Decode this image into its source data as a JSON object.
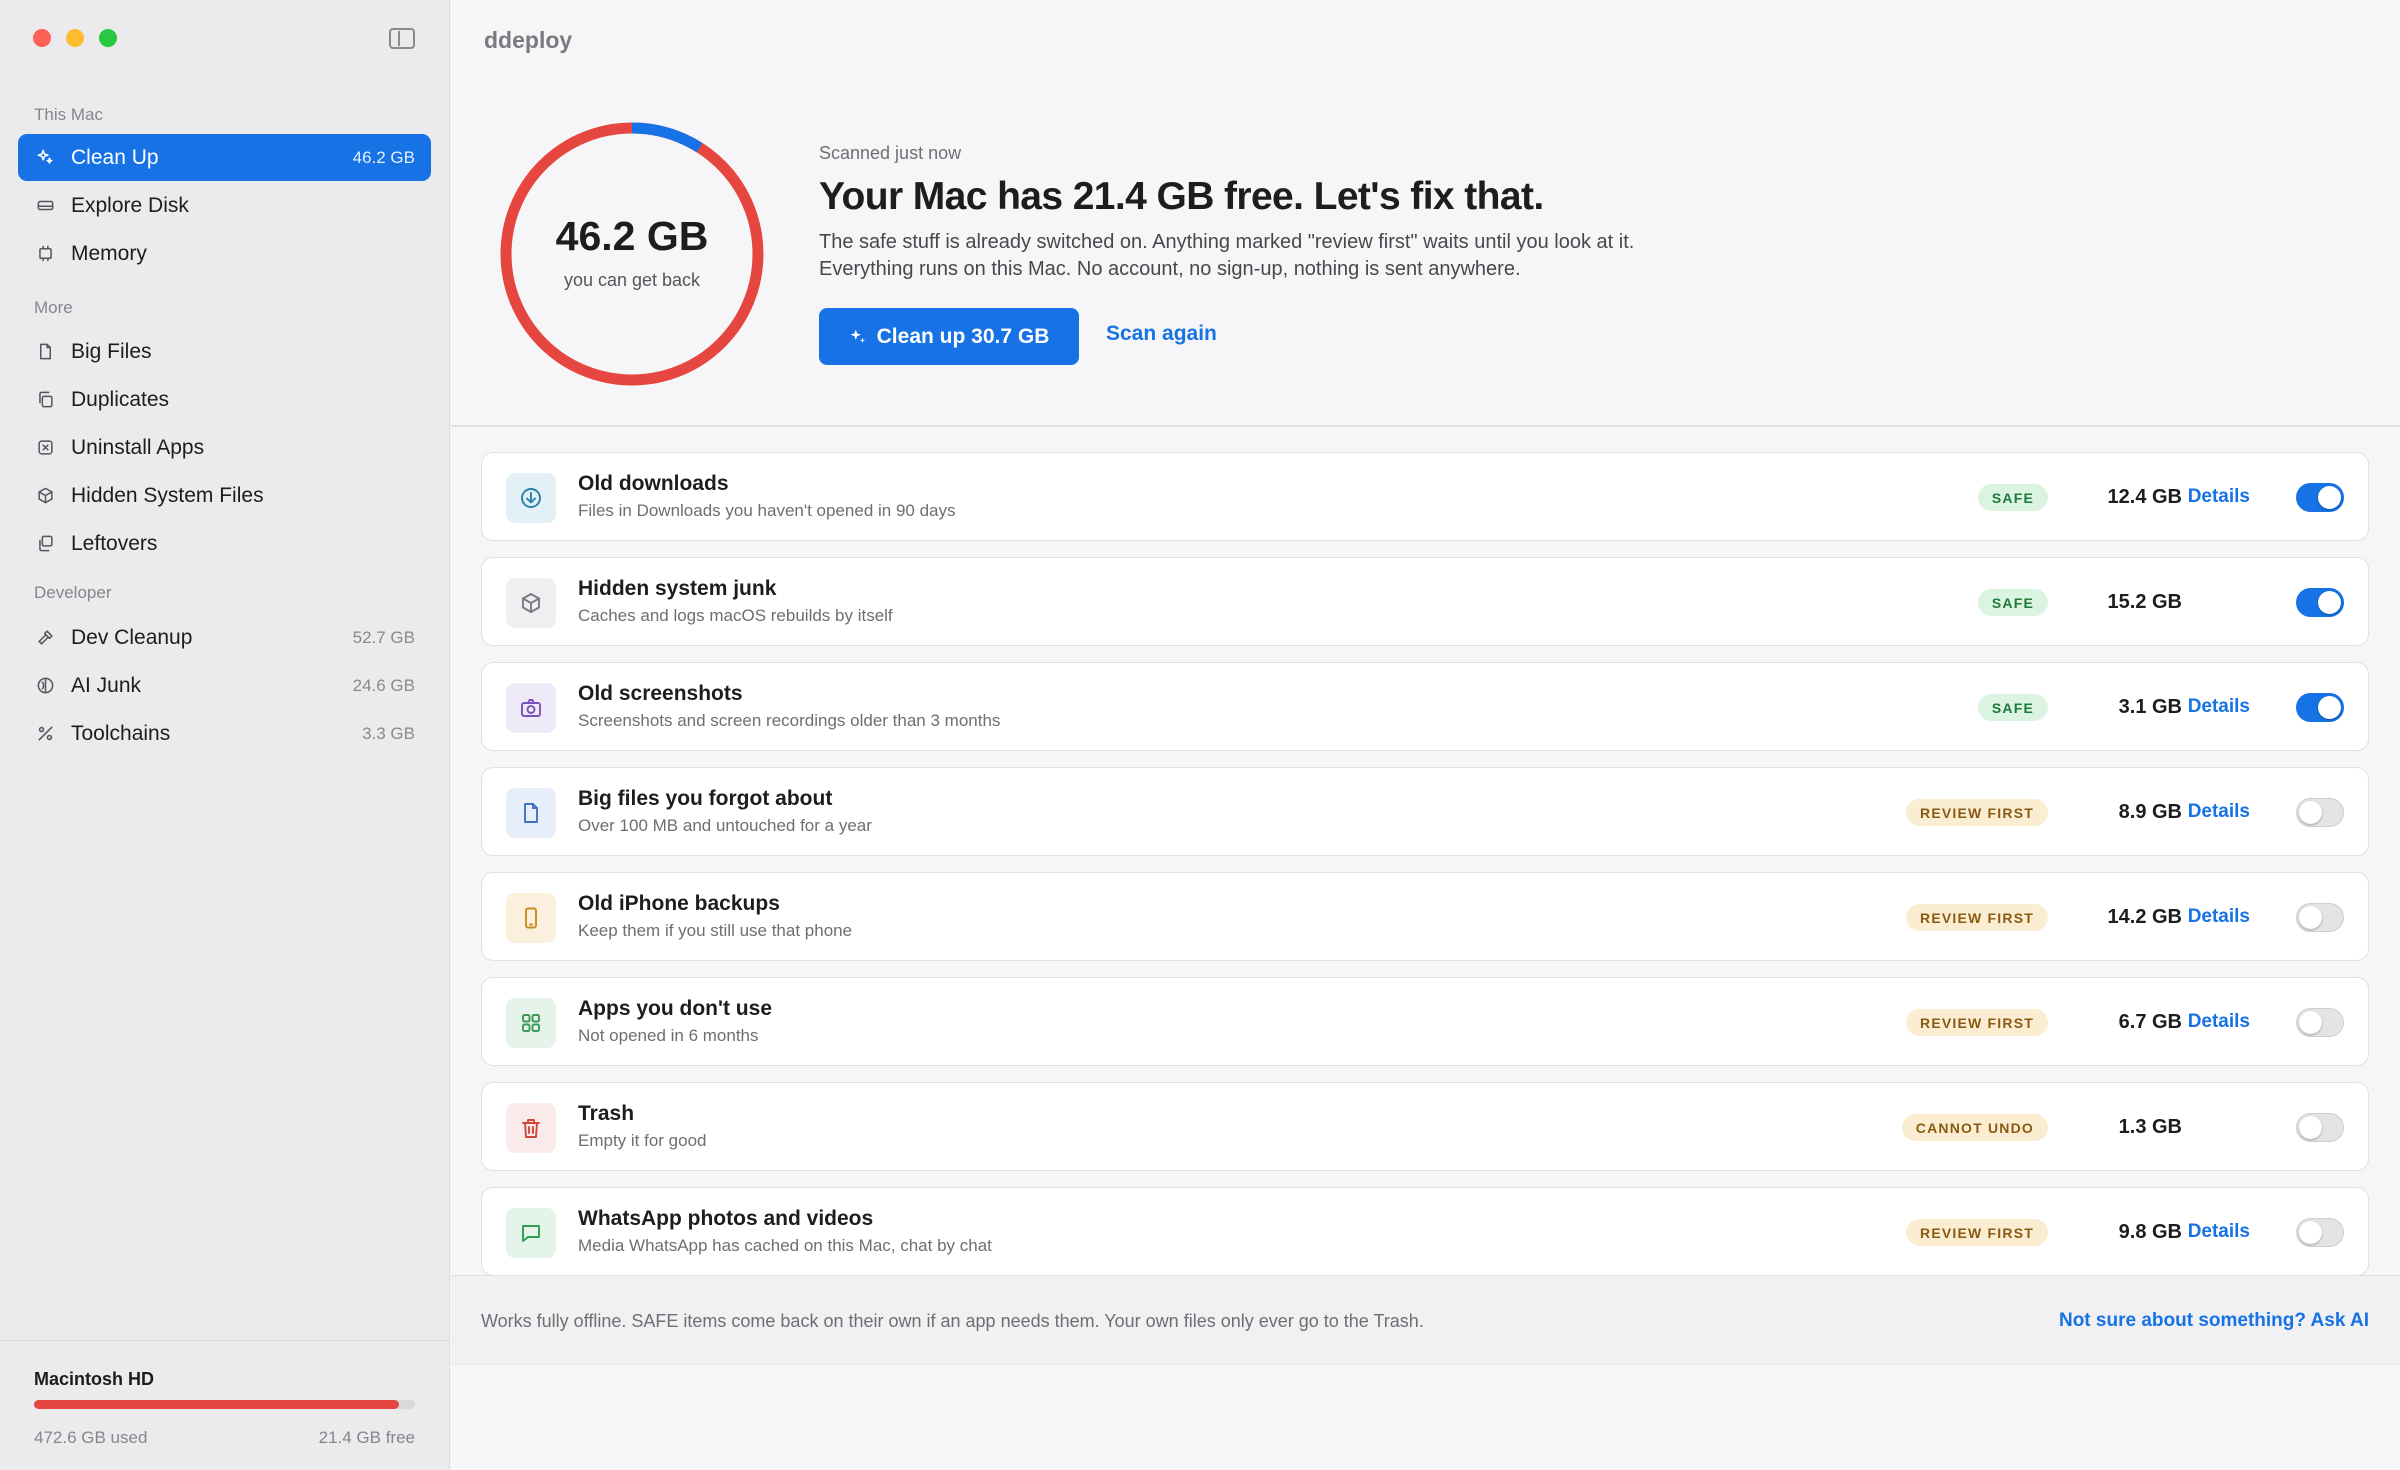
{
  "window": {
    "title": "ddeploy"
  },
  "sidebar": {
    "sections": [
      {
        "header": "This Mac",
        "items": [
          {
            "label": "Clean Up",
            "count": "46.2 GB",
            "icon": "sparkles-icon",
            "active": true
          },
          {
            "label": "Explore Disk",
            "count": "",
            "icon": "drive-icon"
          },
          {
            "label": "Memory",
            "count": "",
            "icon": "memory-chip-icon"
          }
        ]
      },
      {
        "header": "More",
        "items": [
          {
            "label": "Big Files",
            "count": "",
            "icon": "document-icon"
          },
          {
            "label": "Duplicates",
            "count": "",
            "icon": "duplicate-icon"
          },
          {
            "label": "Uninstall Apps",
            "count": "",
            "icon": "xmark-square-icon"
          },
          {
            "label": "Hidden System Files",
            "count": "",
            "icon": "cube-icon"
          },
          {
            "label": "Leftovers",
            "count": "",
            "icon": "leftovers-icon"
          }
        ]
      },
      {
        "header": "Developer",
        "items": [
          {
            "label": "Dev Cleanup",
            "count": "52.7 GB",
            "icon": "hammer-icon"
          },
          {
            "label": "AI Junk",
            "count": "24.6 GB",
            "icon": "ai-brain-icon"
          },
          {
            "label": "Toolchains",
            "count": "3.3 GB",
            "icon": "wrench-screwdriver-icon"
          }
        ]
      }
    ],
    "disk": {
      "name": "Macintosh HD",
      "used": "472.6 GB used",
      "free": "21.4 GB free",
      "used_fraction": 0.957
    }
  },
  "hero": {
    "reclaimable": "46.2 GB",
    "reclaimable_caption": "you can get back",
    "ring_blue_fraction": 0.09,
    "scanned": "Scanned just now",
    "headline": "Your Mac has 21.4 GB free. Let's fix that.",
    "desc1": "The safe stuff is already switched on. Anything marked \"review first\" waits until you look at it.",
    "desc2": "Everything runs on this Mac. No account, no sign-up, nothing is sent anywhere.",
    "primary_label": "Clean up 30.7 GB",
    "secondary_label": "Scan again"
  },
  "items": [
    {
      "title": "Old downloads",
      "sub": "Files in Downloads you haven't opened in 90 days",
      "badge": "SAFE",
      "kind": "safe",
      "size": "12.4 GB",
      "details": "Details",
      "on": true,
      "icon": "download-icon",
      "tint": "#e3f0f5",
      "color": "#2a7fa8"
    },
    {
      "title": "Hidden system junk",
      "sub": "Caches and logs macOS rebuilds by itself",
      "badge": "SAFE",
      "kind": "safe",
      "size": "15.2 GB",
      "details": "",
      "on": true,
      "icon": "cube-icon",
      "tint": "#efeff1",
      "color": "#7a7a80"
    },
    {
      "title": "Old screenshots",
      "sub": "Screenshots and screen recordings older than 3 months",
      "badge": "SAFE",
      "kind": "safe",
      "size": "3.1 GB",
      "details": "Details",
      "on": true,
      "icon": "camera-icon",
      "tint": "#efeaf7",
      "color": "#7b52b8"
    },
    {
      "title": "Big files you forgot about",
      "sub": "Over 100 MB and untouched for a year",
      "badge": "REVIEW FIRST",
      "kind": "review",
      "size": "8.9 GB",
      "details": "Details",
      "on": false,
      "icon": "document-icon",
      "tint": "#e6eefa",
      "color": "#3f73c4"
    },
    {
      "title": "Old iPhone backups",
      "sub": "Keep them if you still use that phone",
      "badge": "REVIEW FIRST",
      "kind": "review",
      "size": "14.2 GB",
      "details": "Details",
      "on": false,
      "icon": "iphone-icon",
      "tint": "#faf0dd",
      "color": "#c98a22"
    },
    {
      "title": "Apps you don't use",
      "sub": "Not opened in 6 months",
      "badge": "REVIEW FIRST",
      "kind": "review",
      "size": "6.7 GB",
      "details": "Details",
      "on": false,
      "icon": "app-grid-icon",
      "tint": "#e6f3ea",
      "color": "#3a9a5a"
    },
    {
      "title": "Trash",
      "sub": "Empty it for good",
      "badge": "CANNOT UNDO",
      "kind": "cannot",
      "size": "1.3 GB",
      "details": "",
      "on": false,
      "icon": "trash-icon",
      "tint": "#fbeaea",
      "color": "#d0463f"
    },
    {
      "title": "WhatsApp photos and videos",
      "sub": "Media WhatsApp has cached on this Mac, chat by chat",
      "badge": "REVIEW FIRST",
      "kind": "review",
      "size": "9.8 GB",
      "details": "Details",
      "on": false,
      "icon": "chat-bubble-icon",
      "tint": "#e4f4e8",
      "color": "#2f9e4f"
    }
  ],
  "footer": {
    "note": "Works fully offline. SAFE items come back on their own if an app needs them. Your own files only ever go to the Trash.",
    "ai_link": "Not sure about something? Ask AI"
  }
}
